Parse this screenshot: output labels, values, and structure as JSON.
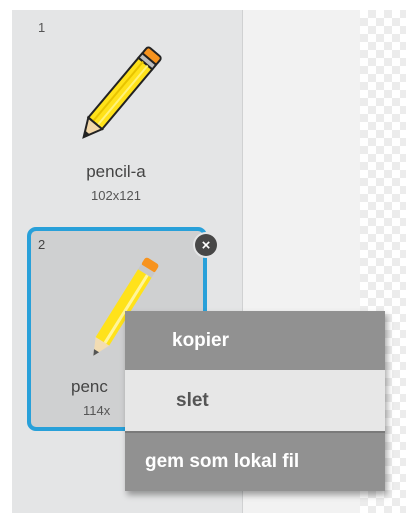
{
  "costumes": [
    {
      "number": "1",
      "name": "pencil-a",
      "size": "102x121",
      "selected": false
    },
    {
      "number": "2",
      "name": "penc",
      "size": "114x",
      "selected": true
    }
  ],
  "delete_icon": "close-icon",
  "context_menu": {
    "copy_label": "kopier",
    "delete_label": "slet",
    "export_label": "gem som lokal fil"
  },
  "colors": {
    "selection_border": "#28a0d9",
    "menu_dark": "#919191",
    "menu_light": "#e7e7e7",
    "pencil_body": "#ffe21a",
    "pencil_eraser": "#f7931e"
  }
}
